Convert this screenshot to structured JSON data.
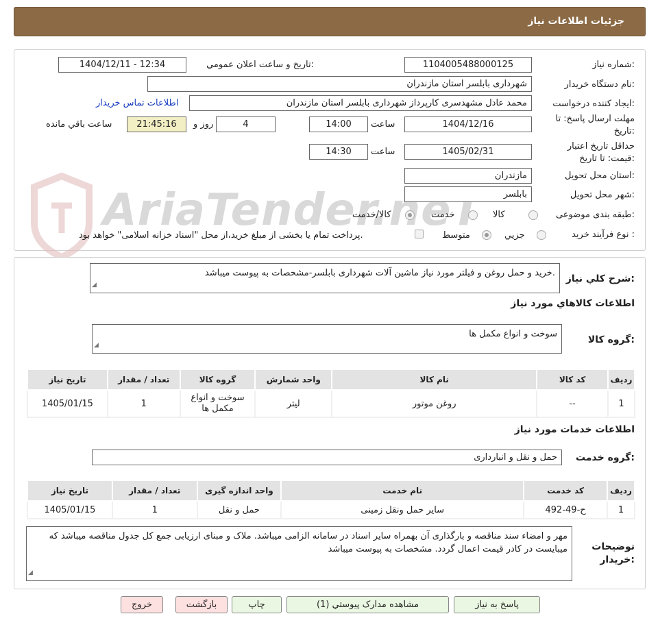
{
  "header": {
    "title": "جزئيات اطلاعات نياز"
  },
  "fields": {
    "need_number_label": "شماره نياز:",
    "need_number": "1104005488000125",
    "announce_label": "تاريخ و ساعت اعلان عمومي:",
    "announce_value": "1404/12/11 - 12:34",
    "buyer_org_label": "نام دستگاه خريدار:",
    "buyer_org": "شهرداری بابلسر استان مازندران",
    "requester_label": "ايجاد کننده درخواست:",
    "requester": "محمد عادل مشهدسری کارپرداز شهرداری بابلسر استان مازندران",
    "contact_link": "اطلاعات تماس خريدار",
    "deadline_label_1": "مهلت ارسال پاسخ: تا",
    "deadline_label_2": "تاريخ:",
    "deadline_date": "1404/12/16",
    "time_label": "ساعت",
    "deadline_time": "14:00",
    "days_value": "4",
    "days_label": "روز و",
    "remaining_time": "21:45:16",
    "remaining_label": "ساعت باقي مانده",
    "validity_label_1": "حداقل تاريخ اعتبار",
    "validity_label_2": "قيمت: تا تاريخ:",
    "validity_date": "1405/02/31",
    "validity_time": "14:30",
    "province_label": "استان محل تحويل:",
    "province": "مازندران",
    "city_label": "شهر محل تحويل:",
    "city": "بابلسر",
    "category_label": "طبقه بندی موضوعی:",
    "category_options": [
      "کالا",
      "خدمت",
      "کالا/خدمت"
    ],
    "process_label": "نوع فرآيند خريد :",
    "process_options": [
      "جزيي",
      "متوسط"
    ],
    "payment_note": "پرداخت تمام يا بخشی از مبلغ خريد،از محل \"اسناد خزانه اسلامی\" خواهد بود."
  },
  "summary": {
    "label": "شرح کلي نياز:",
    "text": "خريد و حمل روغن و فيلتر مورد نياز ماشين آلات شهرداری بابلسر-مشخصات به پيوست ميباشد."
  },
  "goods": {
    "section_title": "اطلاعات کالاهاي مورد نياز",
    "group_label": "گروه کالا:",
    "group_value": "سوخت و انواع مکمل ها",
    "headers": [
      "رديف",
      "کد کالا",
      "نام کالا",
      "واحد شمارش",
      "گروه کالا",
      "تعداد / مقدار",
      "تاريخ نياز"
    ],
    "rows": [
      [
        "1",
        "--",
        "روغن موتور",
        "ليتر",
        "سوخت و انواع مکمل ها",
        "1",
        "1405/01/15"
      ]
    ]
  },
  "services": {
    "section_title": "اطلاعات خدمات مورد نياز",
    "group_label": "گروه خدمت:",
    "group_value": "حمل و نقل و انبارداری",
    "headers": [
      "رديف",
      "کد خدمت",
      "نام خدمت",
      "واحد اندازه گيری",
      "تعداد / مقدار",
      "تاريخ نياز"
    ],
    "rows": [
      [
        "1",
        "ح-49-492",
        "ساير حمل ونقل زمينی",
        "حمل و نقل",
        "1",
        "1405/01/15"
      ]
    ]
  },
  "notes": {
    "label_1": "توضيحات",
    "label_2": "خريدار:",
    "text": "مهر و امضاء سند مناقصه و بارگذاری آن بهمراه ساير اسناد در سامانه الزامی ميباشد. ملاک و مبنای ارزيابی جمع کل جدول مناقصه ميباشد که ميبايست در کادر قيمت اعمال گردد. مشخصات به پيوست ميباشد"
  },
  "buttons": {
    "reply": "پاسخ به نياز",
    "attachments": "مشاهده مدارک پيوستي (1)",
    "print": "چاپ",
    "back": "بازگشت",
    "exit": "خروج"
  },
  "watermark": {
    "text": "AriaTender.neT"
  },
  "colors": {
    "title_bar": "#8b6a45",
    "link": "#1a3fbf",
    "remaining_bg": "#f3efc4",
    "button_green": "#eaf7e2",
    "button_pink": "#fde0e0"
  }
}
